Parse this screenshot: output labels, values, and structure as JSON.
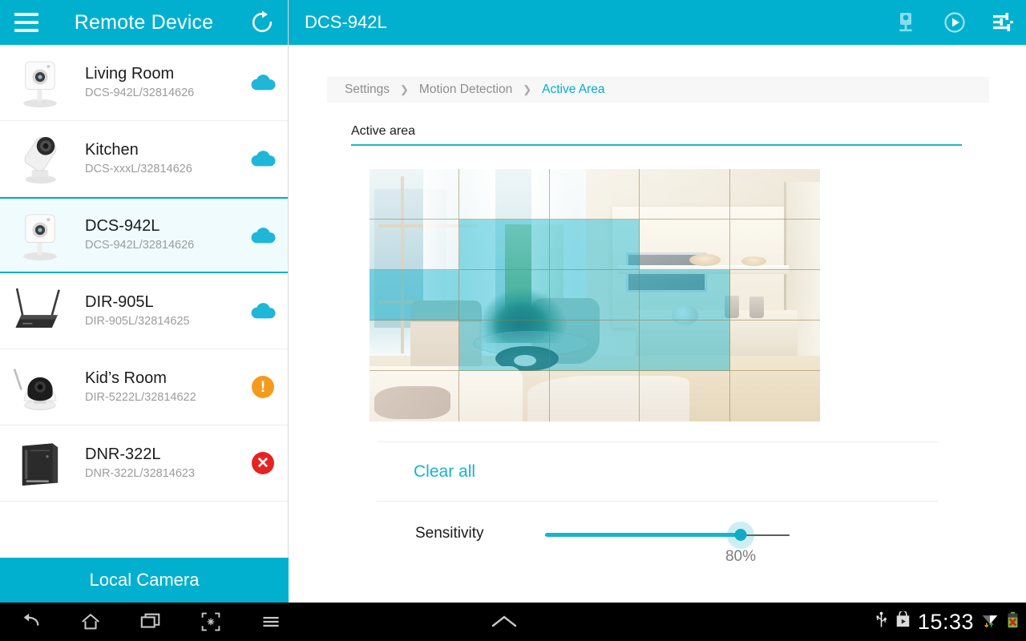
{
  "sidebar": {
    "title": "Remote Device",
    "menu_icon": "hamburger-icon",
    "refresh_icon": "refresh-icon",
    "local_camera_label": "Local Camera",
    "devices": [
      {
        "name": "Living Room",
        "model": "DCS-942L/32814626",
        "status": "cloud",
        "thumb": "camera-cube-icon",
        "selected": false
      },
      {
        "name": "Kitchen",
        "model": "DCS-xxxL/32814626",
        "status": "cloud",
        "thumb": "camera-bullet-icon",
        "selected": false
      },
      {
        "name": "DCS-942L",
        "model": "DCS-942L/32814626",
        "status": "cloud",
        "thumb": "camera-cube-icon",
        "selected": true
      },
      {
        "name": "DIR-905L",
        "model": "DIR-905L/32814625",
        "status": "cloud",
        "thumb": "router-icon",
        "selected": false
      },
      {
        "name": "Kid’s Room",
        "model": "DIR-5222L/32814622",
        "status": "warning",
        "thumb": "camera-ptz-icon",
        "selected": false
      },
      {
        "name": "DNR-322L",
        "model": "DNR-322L/32814623",
        "status": "error",
        "thumb": "nvr-icon",
        "selected": false
      }
    ],
    "status_glyphs": {
      "warning": "!",
      "error": "✕"
    }
  },
  "main": {
    "title": "DCS-942L",
    "actions": [
      {
        "name": "live-view-icon"
      },
      {
        "name": "play-icon"
      },
      {
        "name": "settings-sliders-icon"
      }
    ],
    "breadcrumb": [
      {
        "label": "Settings",
        "active": false
      },
      {
        "label": "Motion Detection",
        "active": false
      },
      {
        "label": "Active Area",
        "active": true
      }
    ],
    "breadcrumb_separator": "❯",
    "section_title": "Active area",
    "clear_all_label": "Clear all",
    "sensitivity_label": "Sensitivity",
    "sensitivity_value": "80%",
    "sensitivity_percent": 80,
    "grid": {
      "columns": 5,
      "rows": 5,
      "active_cells": [
        [
          0,
          0,
          0,
          0,
          0
        ],
        [
          0,
          1,
          1,
          0,
          0
        ],
        [
          1,
          1,
          1,
          1,
          0
        ],
        [
          0,
          1,
          1,
          1,
          0
        ],
        [
          0,
          0,
          0,
          0,
          0
        ]
      ]
    }
  },
  "navbar": {
    "buttons": [
      {
        "name": "back-icon"
      },
      {
        "name": "home-icon"
      },
      {
        "name": "recents-icon"
      },
      {
        "name": "screenshot-icon"
      },
      {
        "name": "menu-icon"
      }
    ],
    "chevron": {
      "name": "chevron-up-icon"
    },
    "tray": [
      {
        "name": "usb-icon"
      },
      {
        "name": "play-store-icon"
      }
    ],
    "clock": "15:33",
    "wifi": {
      "name": "wifi-icon"
    },
    "battery": {
      "name": "battery-error-icon"
    }
  },
  "colors": {
    "accent": "#00b0ce",
    "accent_link": "#18b4d0",
    "warning": "#f59b1c",
    "error": "#e52421",
    "selected_row_bg": "#effbfd"
  }
}
